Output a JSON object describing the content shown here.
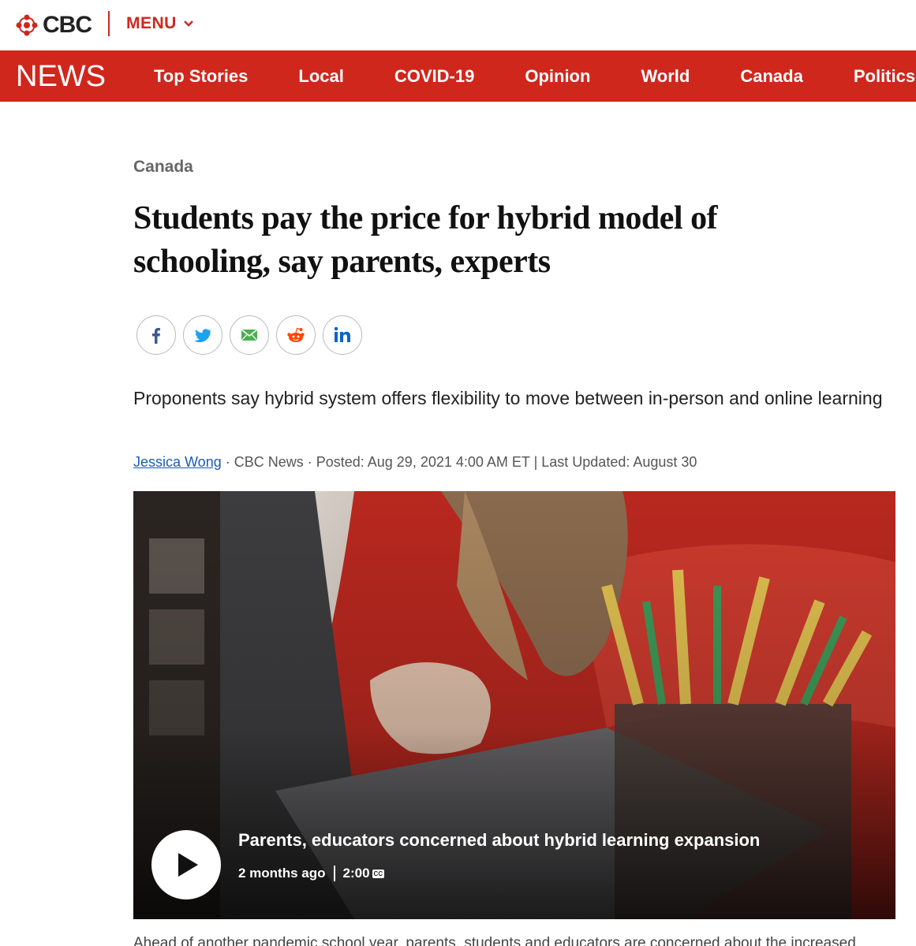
{
  "brand": {
    "logo_text": "CBC",
    "menu_label": "MENU",
    "accent": "#d0271d"
  },
  "news_nav": {
    "label": "NEWS",
    "items": [
      {
        "label": "Top Stories"
      },
      {
        "label": "Local"
      },
      {
        "label": "COVID-19"
      },
      {
        "label": "Opinion"
      },
      {
        "label": "World"
      },
      {
        "label": "Canada"
      },
      {
        "label": "Politics"
      }
    ]
  },
  "article": {
    "section": "Canada",
    "headline": "Students pay the price for hybrid model of schooling, say parents, experts",
    "share": [
      {
        "icon": "facebook-icon",
        "color": "#3b5998"
      },
      {
        "icon": "twitter-icon",
        "color": "#1da1f2"
      },
      {
        "icon": "email-icon",
        "color": "#4caf50"
      },
      {
        "icon": "reddit-icon",
        "color": "#ff4500"
      },
      {
        "icon": "linkedin-icon",
        "color": "#0a66c2"
      }
    ],
    "deck": "Proponents say hybrid system offers flexibility to move between in-person and online learning",
    "byline": {
      "author": "Jessica Wong",
      "source": " · CBC News · Posted: Aug 29, 2021 4:00 AM ET | Last Updated: August 30"
    },
    "video": {
      "title": "Parents, educators concerned about hybrid learning expansion",
      "age": "2 months ago",
      "duration": "2:00",
      "cc": "CC"
    },
    "body_first_line": "Ahead of another pandemic school year, parents, students and educators are concerned about the increased"
  }
}
